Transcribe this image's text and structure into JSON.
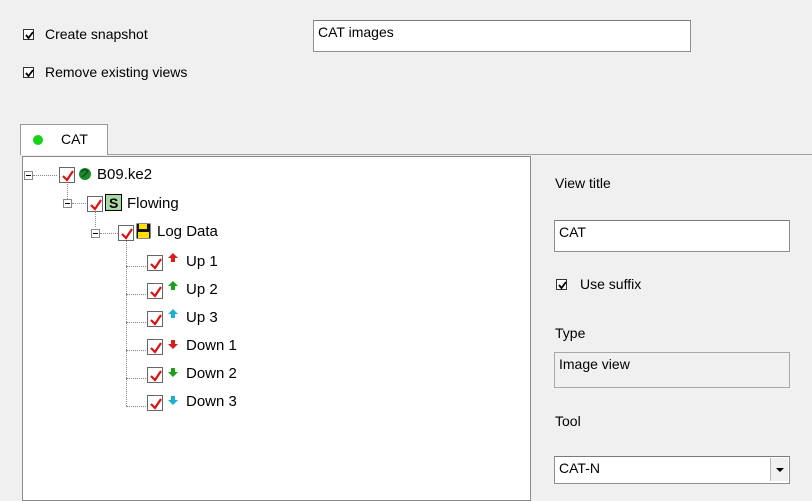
{
  "options": {
    "create_snapshot": {
      "label": "Create snapshot",
      "checked": true
    },
    "remove_existing_views": {
      "label": "Remove existing views",
      "checked": true
    },
    "snapshot_name": "CAT images"
  },
  "tab": {
    "label": "CAT",
    "dot_color": "#17d317"
  },
  "tree": {
    "root": {
      "label": "B09.ke2",
      "icon": "globe-icon"
    },
    "level1": {
      "label": "Flowing",
      "icon": "s-box-icon"
    },
    "level2": {
      "label": "Log Data",
      "icon": "floppy-disk-icon"
    },
    "items": [
      {
        "label": "Up 1",
        "icon": "arrow-up-red-icon",
        "color": "#d81c1c"
      },
      {
        "label": "Up 2",
        "icon": "arrow-up-green-icon",
        "color": "#1aa11a"
      },
      {
        "label": "Up 3",
        "icon": "arrow-up-cyan-icon",
        "color": "#1ab0d6"
      },
      {
        "label": "Down 1",
        "icon": "arrow-down-red-icon",
        "color": "#d81c1c"
      },
      {
        "label": "Down 2",
        "icon": "arrow-down-green-icon",
        "color": "#1aa11a"
      },
      {
        "label": "Down 3",
        "icon": "arrow-down-cyan-icon",
        "color": "#1ab0d6"
      }
    ]
  },
  "details": {
    "view_title_label": "View title",
    "view_title_value": "CAT",
    "use_suffix": {
      "label": "Use suffix",
      "checked": true
    },
    "type_label": "Type",
    "type_value": "Image view",
    "tool_label": "Tool",
    "tool_value": "CAT-N"
  }
}
